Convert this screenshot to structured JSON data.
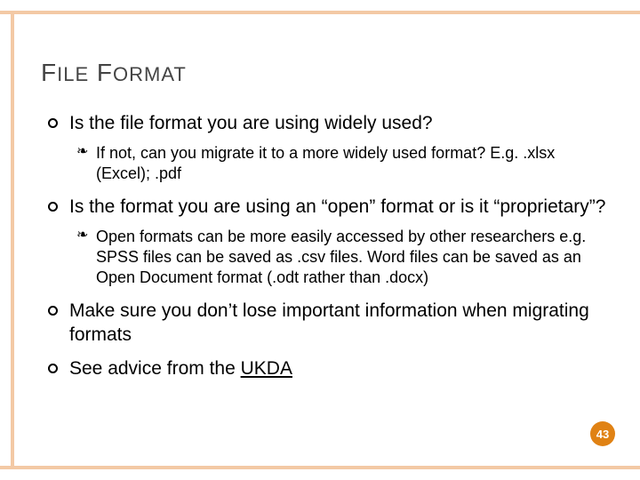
{
  "title": {
    "word1_first": "F",
    "word1_rest": "ILE",
    "word2_first": "F",
    "word2_rest": "ORMAT"
  },
  "bullets": [
    {
      "text": "Is the file format you are using widely used?",
      "sub": [
        "If not, can you migrate it to a more widely used format? E.g. .xlsx (Excel); .pdf"
      ]
    },
    {
      "text": "Is the format you are using an “open” format or is it “proprietary”?",
      "sub": [
        "Open formats can be more easily accessed by other researchers e.g. SPSS files can be saved as .csv files. Word files can be saved as an Open Document format (.odt rather than .docx)"
      ]
    },
    {
      "text": "Make sure you don’t lose important information when migrating formats",
      "sub": []
    },
    {
      "text_prefix": "See advice from the ",
      "link_text": "UKDA",
      "sub": []
    }
  ],
  "page_number": "43"
}
